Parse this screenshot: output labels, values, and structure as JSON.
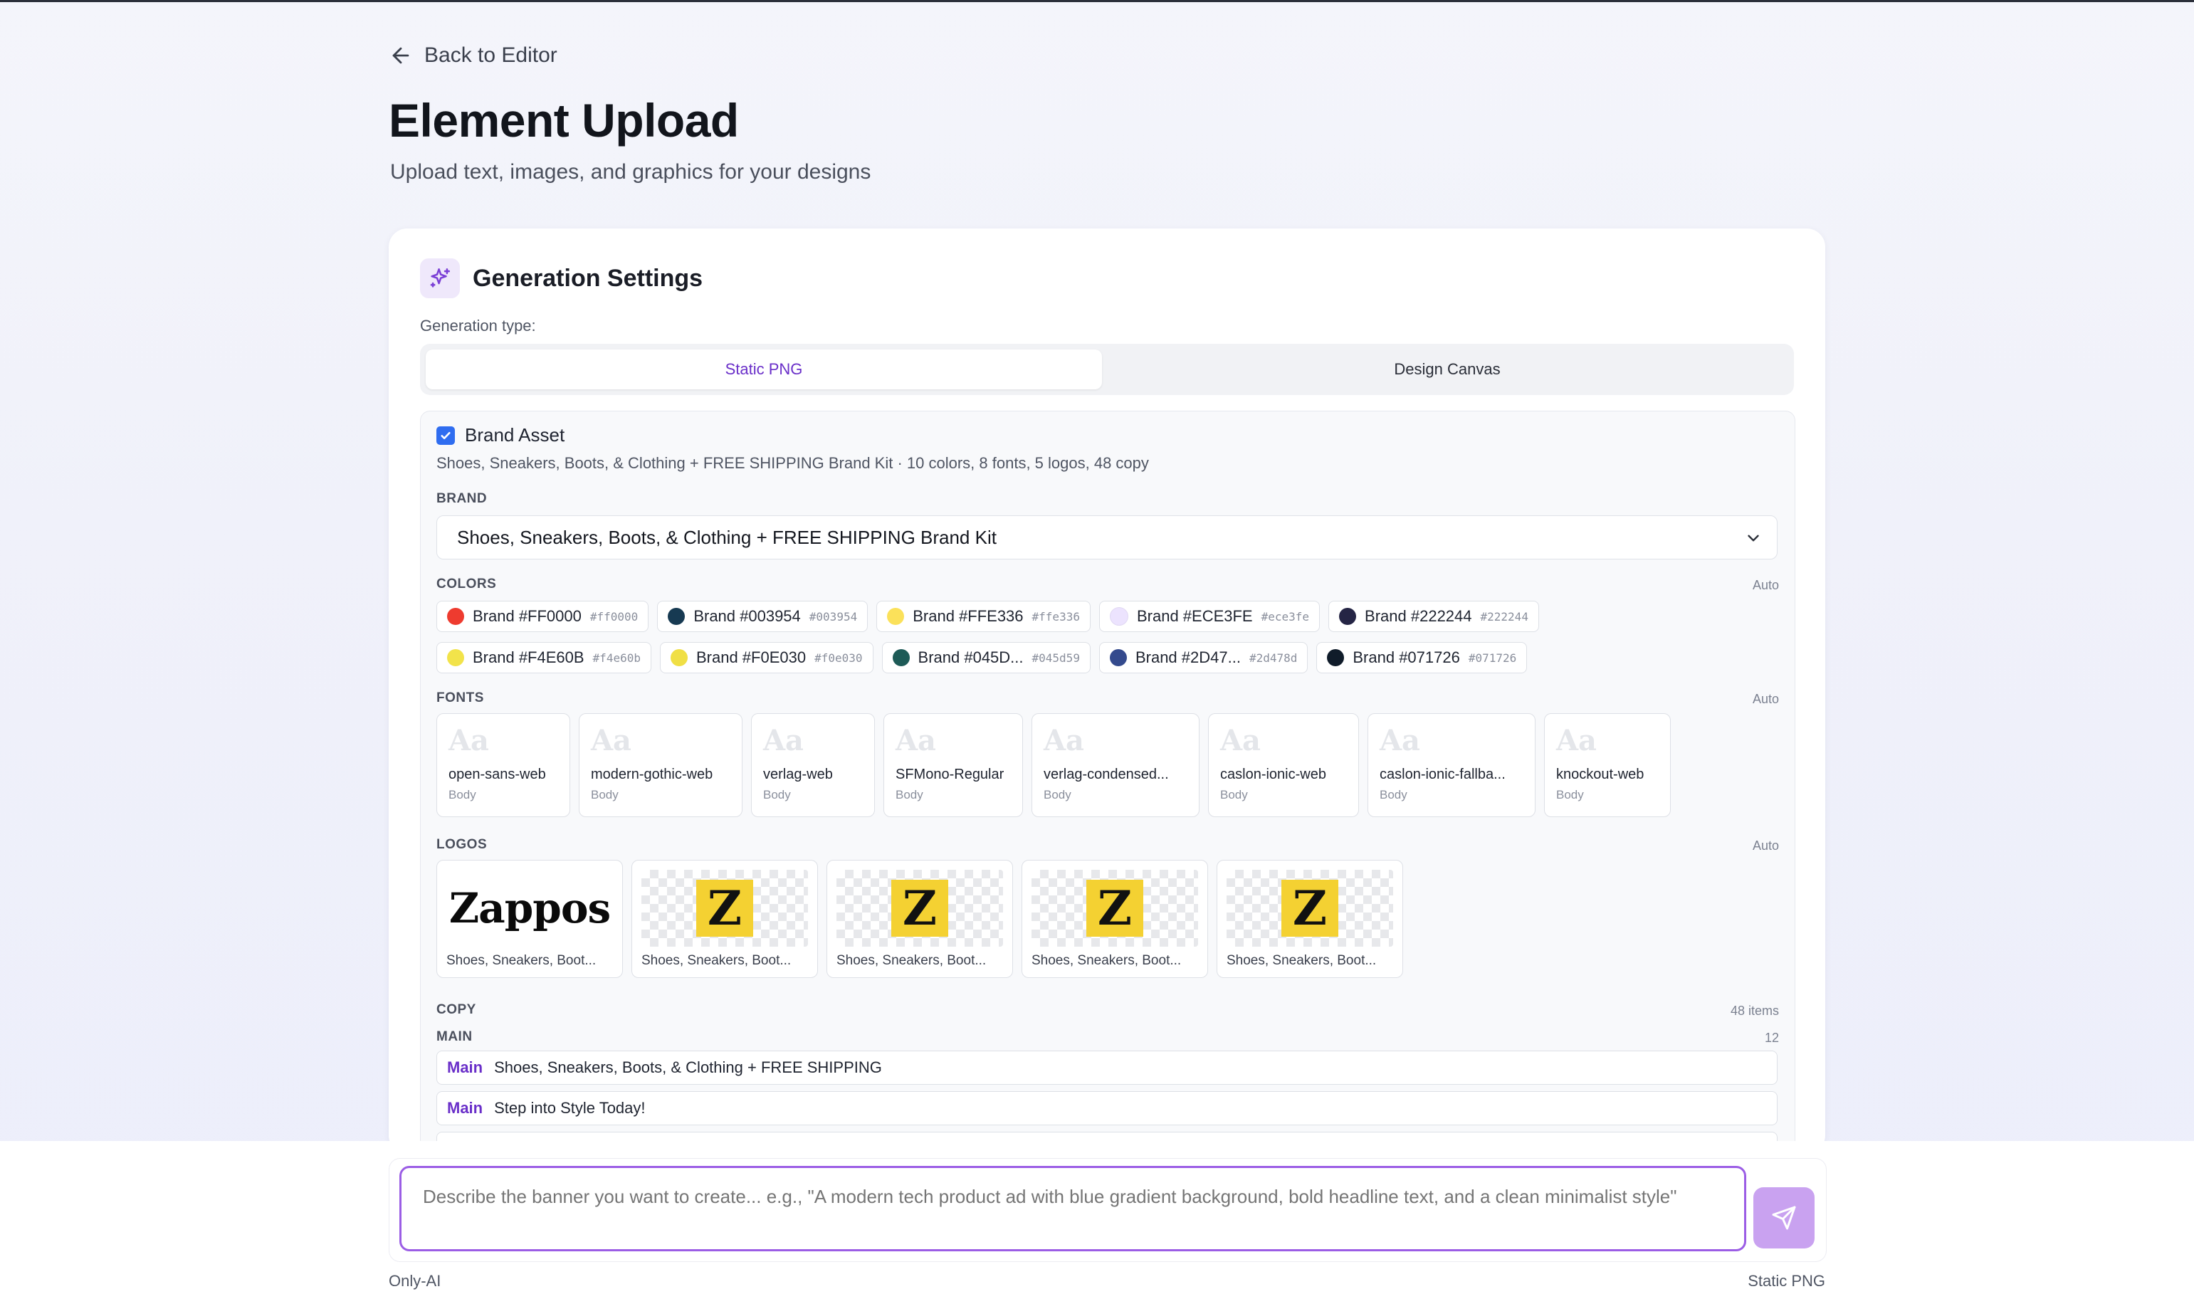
{
  "nav": {
    "back_label": "Back to Editor"
  },
  "page": {
    "title": "Element Upload",
    "subtitle": "Upload text, images, and graphics for your designs"
  },
  "settings": {
    "title": "Generation Settings",
    "generation_type_label": "Generation type:",
    "tabs": [
      {
        "label": "Static PNG",
        "active": true
      },
      {
        "label": "Design Canvas",
        "active": false
      }
    ]
  },
  "brand_asset": {
    "label": "Brand Asset",
    "checked": true,
    "description": "Shoes, Sneakers, Boots, & Clothing + FREE SHIPPING Brand Kit · 10 colors, 8 fonts, 5 logos, 48 copy",
    "brand_label": "BRAND",
    "brand_value": "Shoes, Sneakers, Boots, & Clothing + FREE SHIPPING Brand Kit"
  },
  "colors": {
    "label": "COLORS",
    "auto": "Auto",
    "items": [
      {
        "name": "Brand #FF0000",
        "hex": "#ff0000",
        "swatch": "#ee3b2f"
      },
      {
        "name": "Brand #003954",
        "hex": "#003954",
        "swatch": "#173a52"
      },
      {
        "name": "Brand #FFE336",
        "hex": "#ffe336",
        "swatch": "#fbe15a"
      },
      {
        "name": "Brand #ECE3FE",
        "hex": "#ece3fe",
        "swatch": "#ece3fe"
      },
      {
        "name": "Brand #222244",
        "hex": "#222244",
        "swatch": "#252545"
      },
      {
        "name": "Brand #F4E60B",
        "hex": "#f4e60b",
        "swatch": "#f2e34a"
      },
      {
        "name": "Brand #F0E030",
        "hex": "#f0e030",
        "swatch": "#f0df45"
      },
      {
        "name": "Brand #045D...",
        "hex": "#045d59",
        "swatch": "#1e5b57"
      },
      {
        "name": "Brand #2D47...",
        "hex": "#2d478d",
        "swatch": "#344a8d"
      },
      {
        "name": "Brand #071726",
        "hex": "#071726",
        "swatch": "#101c2a"
      }
    ]
  },
  "fonts": {
    "label": "FONTS",
    "auto": "Auto",
    "sample": "Aa",
    "items": [
      {
        "name": "open-sans-web",
        "role": "Body"
      },
      {
        "name": "modern-gothic-web",
        "role": "Body"
      },
      {
        "name": "verlag-web",
        "role": "Body"
      },
      {
        "name": "SFMono-Regular",
        "role": "Body"
      },
      {
        "name": "verlag-condensed...",
        "role": "Body"
      },
      {
        "name": "caslon-ionic-web",
        "role": "Body"
      },
      {
        "name": "caslon-ionic-fallba...",
        "role": "Body"
      },
      {
        "name": "knockout-web",
        "role": "Body"
      }
    ]
  },
  "logos": {
    "label": "LOGOS",
    "auto": "Auto",
    "items": [
      {
        "caption": "Shoes, Sneakers, Boot...",
        "mark": "Zappos",
        "kind": "wordmark"
      },
      {
        "caption": "Shoes, Sneakers, Boot...",
        "mark": "Z",
        "kind": "icon"
      },
      {
        "caption": "Shoes, Sneakers, Boot...",
        "mark": "Z",
        "kind": "icon"
      },
      {
        "caption": "Shoes, Sneakers, Boot...",
        "mark": "Z",
        "kind": "icon"
      },
      {
        "caption": "Shoes, Sneakers, Boot...",
        "mark": "Z",
        "kind": "icon"
      }
    ]
  },
  "copy": {
    "label": "COPY",
    "count": "48 items",
    "group_label": "MAIN",
    "group_count": "12",
    "items": [
      {
        "tag": "Main",
        "text": "Shoes, Sneakers, Boots, & Clothing + FREE SHIPPING"
      },
      {
        "tag": "Main",
        "text": "Step into Style Today!"
      }
    ]
  },
  "composer": {
    "placeholder": "Describe the banner you want to create... e.g., \"A modern tech product ad with blue gradient background, bold headline text, and a clean minimalist style\"",
    "send_icon": "send-icon"
  },
  "footer": {
    "left": "Only-AI",
    "right": "Static PNG"
  },
  "theme": {
    "accent": "#6a2fc9",
    "focus": "#9b5de5",
    "send_bg": "#c9a2f0"
  }
}
